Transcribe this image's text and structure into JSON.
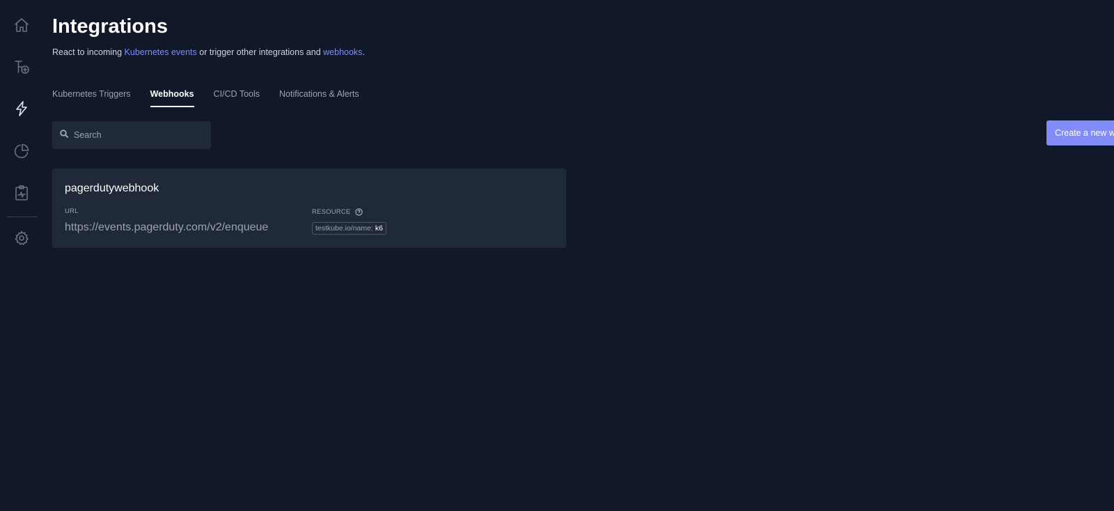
{
  "sidebar": {
    "items": [
      {
        "name": "home",
        "icon": "home-icon"
      },
      {
        "name": "add-test",
        "icon": "add-flow-icon"
      },
      {
        "name": "integrations",
        "icon": "lightning-icon",
        "active": true
      },
      {
        "name": "analytics",
        "icon": "pie-chart-icon"
      },
      {
        "name": "reports",
        "icon": "clipboard-pulse-icon"
      },
      {
        "name": "settings",
        "icon": "gear-icon"
      }
    ]
  },
  "header": {
    "title": "Integrations",
    "subtitle": {
      "prefix": "React to incoming ",
      "link1": "Kubernetes events",
      "middle": " or trigger other integrations and ",
      "link2": "webhooks",
      "suffix": "."
    }
  },
  "tabs": [
    {
      "label": "Kubernetes Triggers",
      "active": false
    },
    {
      "label": "Webhooks",
      "active": true
    },
    {
      "label": "CI/CD Tools",
      "active": false
    },
    {
      "label": "Notifications & Alerts",
      "active": false
    }
  ],
  "search": {
    "placeholder": "Search",
    "value": ""
  },
  "actions": {
    "create_label": "Create a new webhook"
  },
  "webhooks": [
    {
      "name": "pagerdutywebhook",
      "url_label": "URL",
      "url": "https://events.pagerduty.com/v2/enqueue",
      "resource_label": "RESOURCE",
      "resource_key": "testkube.io/name:",
      "resource_value": "k6"
    }
  ],
  "colors": {
    "background": "#111827",
    "card": "#1f2937",
    "accent": "#818cf8"
  }
}
